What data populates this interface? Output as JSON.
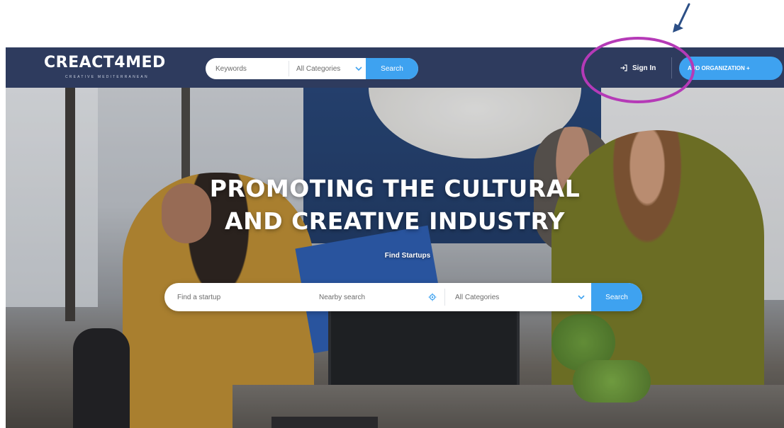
{
  "header": {
    "logo": "CREACT4MED",
    "logo_tagline": "CREATIVE MEDITERRANEAN",
    "search": {
      "keywords_placeholder": "Keywords",
      "category_selected": "All Categories",
      "button_label": "Search"
    },
    "sign_in_label": "Sign In",
    "add_org_label": "ADD ORGANIZATION +"
  },
  "hero": {
    "title_line1": "PROMOTING THE CULTURAL",
    "title_line2": "AND CREATIVE INDUSTRY",
    "subtitle": "Find Startups",
    "search": {
      "startup_placeholder": "Find a startup",
      "nearby_placeholder": "Nearby search",
      "category_selected": "All Categories",
      "button_label": "Search"
    }
  },
  "icons": {
    "signin": "sign-in-icon",
    "chevron": "chevron-down-icon",
    "location": "location-icon"
  },
  "colors": {
    "header_bg": "#2e3b5e",
    "accent": "#3ea2f0",
    "annotation": "#b53ab7",
    "arrow": "#2c4f86"
  }
}
